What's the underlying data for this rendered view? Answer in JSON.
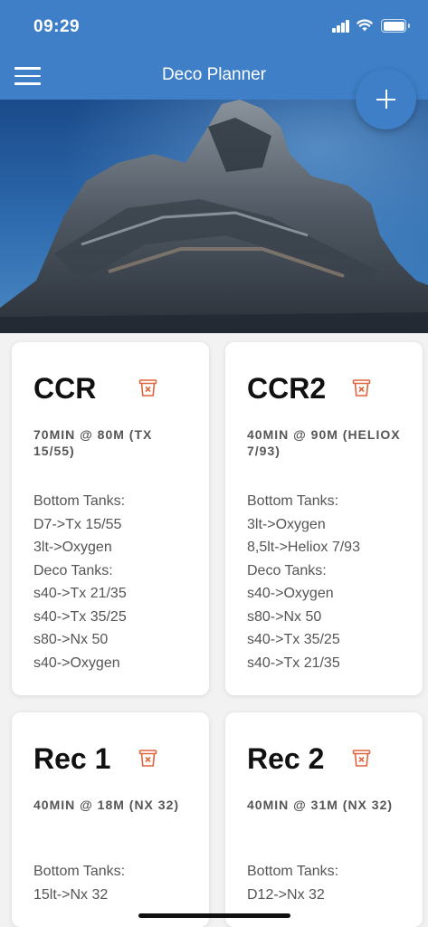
{
  "status_bar": {
    "time": "09:29"
  },
  "header": {
    "title": "Deco Planner"
  },
  "icons": {
    "menu": "hamburger-menu-icon",
    "add": "plus-icon",
    "delete": "trash-bin-icon"
  },
  "colors": {
    "primary": "#3e7fc7",
    "delete": "#e0643a",
    "text": "#111111",
    "subtext": "#555555"
  },
  "plans": [
    {
      "name": "CCR",
      "summary": "70MIN @ 80M (TX 15/55)",
      "tanks": [
        "Bottom Tanks:",
        "D7->Tx 15/55",
        "3lt->Oxygen",
        "Deco Tanks:",
        "s40->Tx 21/35",
        "s40->Tx 35/25",
        "s80->Nx 50",
        "s40->Oxygen"
      ]
    },
    {
      "name": "CCR2",
      "summary": "40MIN @ 90M (HELIOX 7/93)",
      "tanks": [
        "Bottom Tanks:",
        "3lt->Oxygen",
        "8,5lt->Heliox 7/93",
        "Deco Tanks:",
        "s40->Oxygen",
        "s80->Nx 50",
        "s40->Tx 35/25",
        "s40->Tx 21/35"
      ]
    },
    {
      "name": "Rec 1",
      "summary": "40MIN @ 18M (NX 32)",
      "tanks": [
        "Bottom Tanks:",
        "15lt->Nx 32"
      ]
    },
    {
      "name": "Rec 2",
      "summary": "40MIN @ 31M (NX 32)",
      "tanks": [
        "Bottom Tanks:",
        "D12->Nx 32"
      ]
    }
  ]
}
